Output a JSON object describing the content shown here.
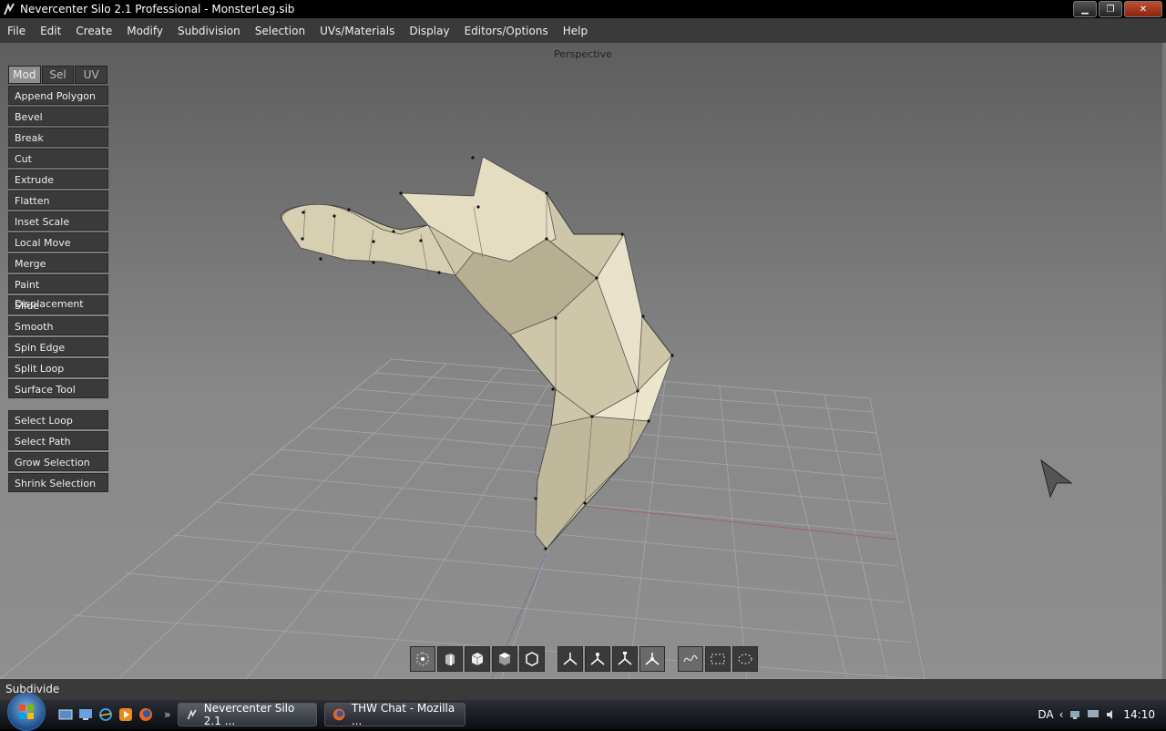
{
  "window": {
    "title": "Nevercenter Silo 2.1 Professional - MonsterLeg.sib"
  },
  "menu": [
    "File",
    "Edit",
    "Create",
    "Modify",
    "Subdivision",
    "Selection",
    "UVs/Materials",
    "Display",
    "Editors/Options",
    "Help"
  ],
  "viewport": {
    "label": "Perspective"
  },
  "mode_tabs": [
    {
      "label": "Mod",
      "active": true
    },
    {
      "label": "Sel",
      "active": false
    },
    {
      "label": "UV",
      "active": false
    }
  ],
  "tools": [
    "Append Polygon",
    "Bevel",
    "Break",
    "Cut",
    "Extrude",
    "Flatten",
    "Inset Scale",
    "Local Move",
    "Merge",
    "Paint Displacement",
    "Slide",
    "Smooth",
    "Spin Edge",
    "Split Loop",
    "Surface Tool"
  ],
  "selection_tools": [
    "Select Loop",
    "Select Path",
    "Grow Selection",
    "Shrink Selection"
  ],
  "bottom_toolbar": {
    "component_modes": [
      "object-mode-icon",
      "vertex-mode-icon",
      "edge-mode-icon",
      "face-mode-icon",
      "polygon-mode-icon"
    ],
    "manipulators": [
      "move-manipulator-icon",
      "rotate-manipulator-icon",
      "scale-manipulator-icon",
      "universal-manipulator-icon"
    ],
    "select_modes": [
      "lasso-select-icon",
      "rect-select-icon",
      "paint-select-icon"
    ]
  },
  "status": {
    "text": "Subdivide"
  },
  "taskbar": {
    "tasks": [
      {
        "label": "Nevercenter Silo 2.1 ...",
        "active": true
      },
      {
        "label": "THW Chat - Mozilla ...",
        "active": false
      }
    ],
    "language": "DA",
    "time": "14:10"
  },
  "colors": {
    "panel": "#3a3a3a",
    "mesh": "#d8d0b4",
    "accent_active": "#8e8e8e"
  }
}
